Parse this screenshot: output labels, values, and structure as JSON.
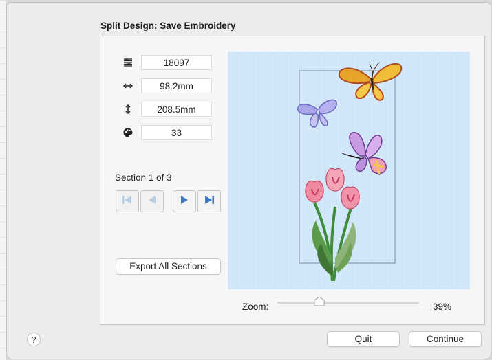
{
  "dialog": {
    "title": "Split Design: Save Embroidery"
  },
  "stats": {
    "stitches": {
      "icon": "stitch-count-icon",
      "value": "18097"
    },
    "width": {
      "icon": "horizontal-arrow-icon",
      "value": "98.2mm"
    },
    "height": {
      "icon": "vertical-arrow-icon",
      "value": "208.5mm"
    },
    "colors": {
      "icon": "palette-icon",
      "value": "33"
    }
  },
  "sections": {
    "label": "Section 1 of 3",
    "nav": [
      "first-section",
      "previous-section",
      "next-section",
      "last-section"
    ],
    "nav_color": "#3d79c4",
    "nav_disabled_color": "#b7cde6"
  },
  "export_button": "Export All Sections",
  "preview": {
    "background": "#cfe6f8",
    "content": [
      "butterfly-icon",
      "butterfly-icon",
      "butterfly-icon",
      "tulip-bouquet-icon"
    ]
  },
  "zoom": {
    "label": "Zoom:",
    "value": "39%",
    "level": 0.39
  },
  "footer": {
    "help": "?",
    "quit": "Quit",
    "continue": "Continue"
  }
}
